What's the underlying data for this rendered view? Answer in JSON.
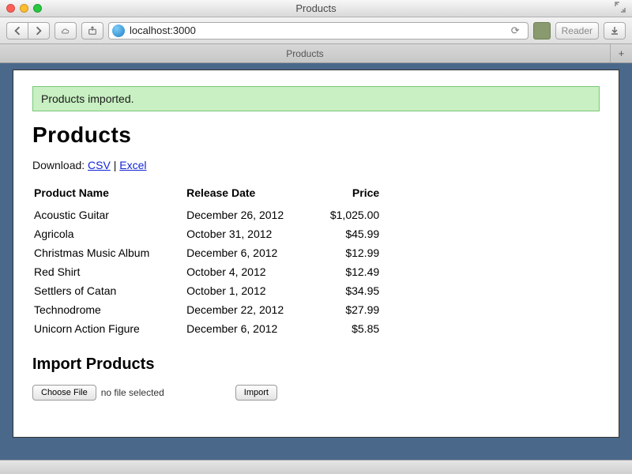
{
  "window": {
    "title": "Products",
    "url": "localhost:3000",
    "reader_label": "Reader",
    "tab_label": "Products"
  },
  "flash": "Products imported.",
  "heading": "Products",
  "download": {
    "prefix": "Download: ",
    "csv": "CSV",
    "sep": " | ",
    "excel": "Excel"
  },
  "table": {
    "headers": {
      "name": "Product Name",
      "date": "Release Date",
      "price": "Price"
    },
    "rows": [
      {
        "name": "Acoustic Guitar",
        "date": "December 26, 2012",
        "price": "$1,025.00"
      },
      {
        "name": "Agricola",
        "date": "October 31, 2012",
        "price": "$45.99"
      },
      {
        "name": "Christmas Music Album",
        "date": "December 6, 2012",
        "price": "$12.99"
      },
      {
        "name": "Red Shirt",
        "date": "October 4, 2012",
        "price": "$12.49"
      },
      {
        "name": "Settlers of Catan",
        "date": "October 1, 2012",
        "price": "$34.95"
      },
      {
        "name": "Technodrome",
        "date": "December 22, 2012",
        "price": "$27.99"
      },
      {
        "name": "Unicorn Action Figure",
        "date": "December 6, 2012",
        "price": "$5.85"
      }
    ]
  },
  "import": {
    "heading": "Import Products",
    "choose_label": "Choose File",
    "status": "no file selected",
    "submit_label": "Import"
  }
}
